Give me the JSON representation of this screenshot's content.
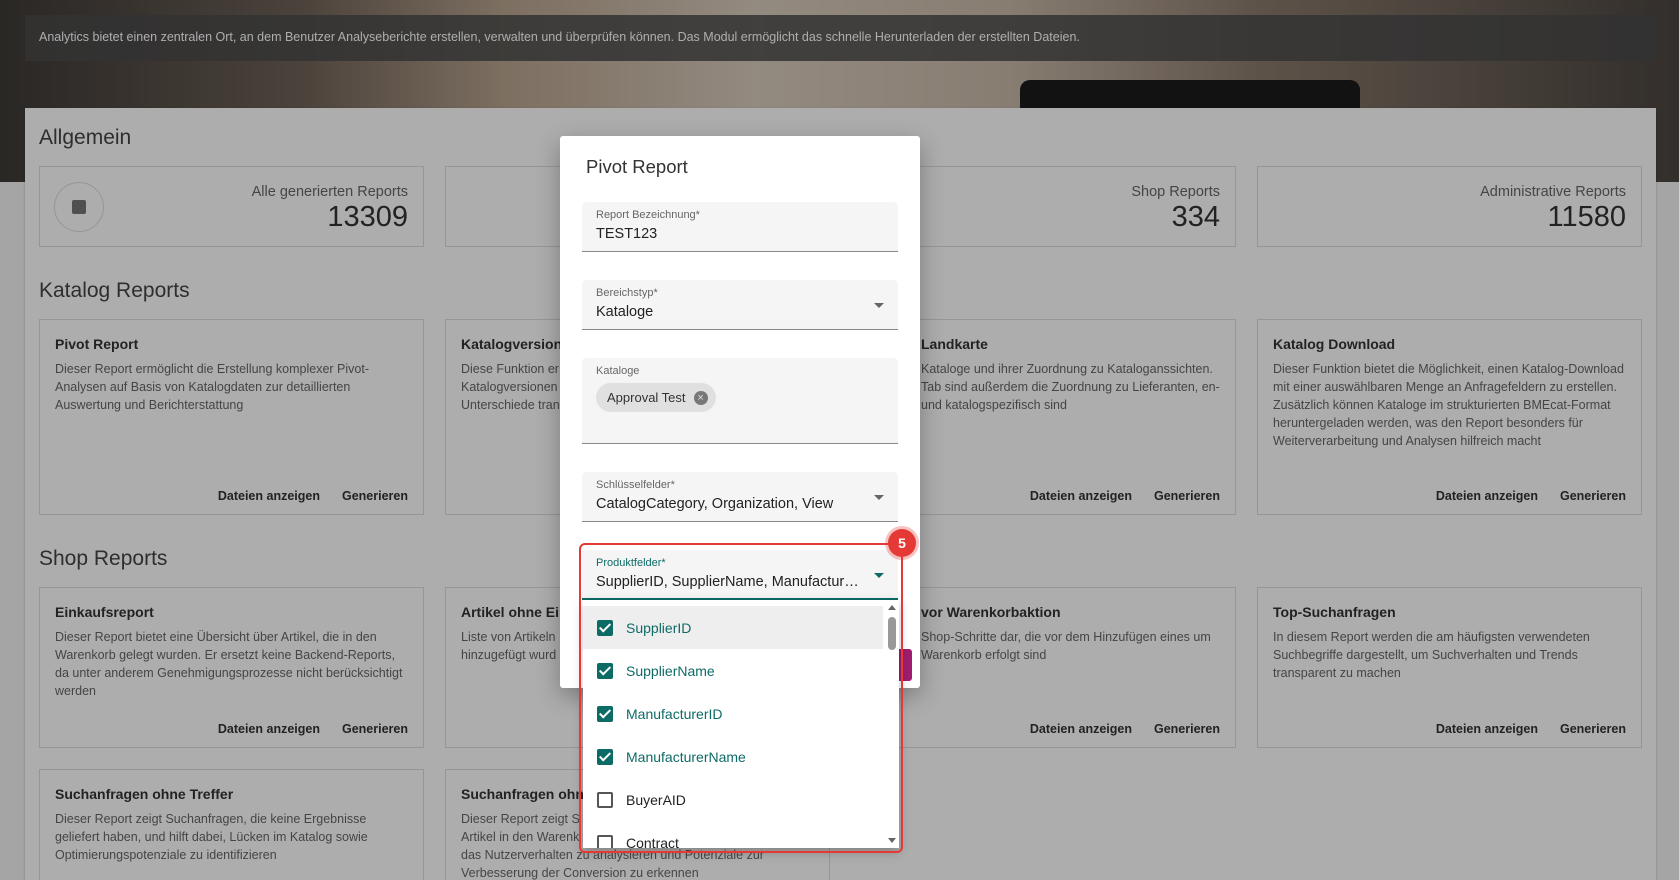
{
  "header": {
    "info": "Analytics bietet einen zentralen Ort, an dem Benutzer Analyseberichte erstellen, verwalten und überprüfen können. Das Modul ermöglicht das schnelle Herunterladen der erstellten Dateien."
  },
  "sections": {
    "allgemein": "Allgemein",
    "katalog": "Katalog Reports",
    "shop": "Shop Reports"
  },
  "stats": [
    {
      "label": "Alle generierten Reports",
      "value": "13309"
    },
    {
      "label": "Shop Reports",
      "value": "334"
    },
    {
      "label": "Administrative Reports",
      "value": "11580"
    }
  ],
  "buttons": {
    "files": "Dateien anzeigen",
    "generate": "Generieren"
  },
  "katalog_cards": [
    {
      "title": "Pivot Report",
      "desc": "Dieser Report ermöglicht die Erstellung komplexer Pivot-Analysen auf Basis von Katalogdaten zur detaillierten Auswertung und Berichterstattung"
    },
    {
      "title": "Katalogversion",
      "desc": "Diese Funktion er\nKatalogversionen\nUnterschiede tran"
    },
    {
      "title": "Landkarte",
      "desc": "Kataloge und ihrer Zuordnung zu Kataloganssichten. Tab sind außerdem die Zuordnung zu Lieferanten, en- und katalogspezifisch sind"
    },
    {
      "title": "Katalog Download",
      "desc": "Dieser Funktion bietet die Möglichkeit, einen Katalog-Download mit einer auswählbaren Menge an Anfragefeldern zu erstellen. Zusätzlich können Kataloge im strukturierten BMEcat-Format heruntergeladen werden, was den Report besonders für Weiterverarbeitung und Analysen hilfreich macht"
    }
  ],
  "shop_cards": [
    {
      "title": "Einkaufsreport",
      "desc": "Dieser Report bietet eine Übersicht über Artikel, die in den Warenkorb gelegt wurden. Er ersetzt keine Backend-Reports, da unter anderem Genehmigungsprozesse nicht berücksichtigt werden"
    },
    {
      "title": "Artikel ohne Ein",
      "desc": "Liste von Artikeln\nhinzugefügt wurd"
    },
    {
      "title": "vor Warenkorbaktion",
      "desc": "Shop-Schritte dar, die vor dem Hinzufügen eines um Warenkorb erfolgt sind"
    },
    {
      "title": "Top-Suchanfragen",
      "desc": "In diesem Report werden die am häufigsten verwendeten Suchbegriffe dargestellt, um Suchverhalten und Trends transparent zu machen"
    },
    {
      "title": "Suchanfragen ohne Treffer",
      "desc": "Dieser Report zeigt Suchanfragen, die keine Ergebnisse geliefert haben, und hilft dabei, Lücken im Katalog sowie Optimierungspotenziale zu identifizieren"
    },
    {
      "title": "Suchanfragen ohn",
      "desc": "Dieser Report zeigt S\nArtikel in den Warenk\ndas Nutzerverhalten zu analysieren und Potenziale zur Verbesserung der Conversion zu erkennen"
    }
  ],
  "dialog": {
    "title": "Pivot Report",
    "report_label": "Report Bezeichnung*",
    "report_value": "TEST123",
    "bereich_label": "Bereichstyp*",
    "bereich_value": "Kataloge",
    "kataloge_label": "Kataloge",
    "kataloge_chip": "Approval Test",
    "schluessel_label": "Schlüsselfelder*",
    "schluessel_value": "CatalogCategory, Organization, View",
    "produkt_label": "Produktfelder*",
    "produkt_value": "SupplierID, SupplierName, ManufacturerID, ManufacturerName"
  },
  "options": [
    {
      "label": "SupplierID",
      "checked": true
    },
    {
      "label": "SupplierName",
      "checked": true
    },
    {
      "label": "ManufacturerID",
      "checked": true
    },
    {
      "label": "ManufacturerName",
      "checked": true
    },
    {
      "label": "BuyerAID",
      "checked": false
    },
    {
      "label": "Contract",
      "checked": false
    }
  ],
  "annotation": {
    "step": "5",
    "color": "#e53935"
  },
  "colors": {
    "accent": "#0d6b66",
    "primary_button": "#a01c6f"
  }
}
